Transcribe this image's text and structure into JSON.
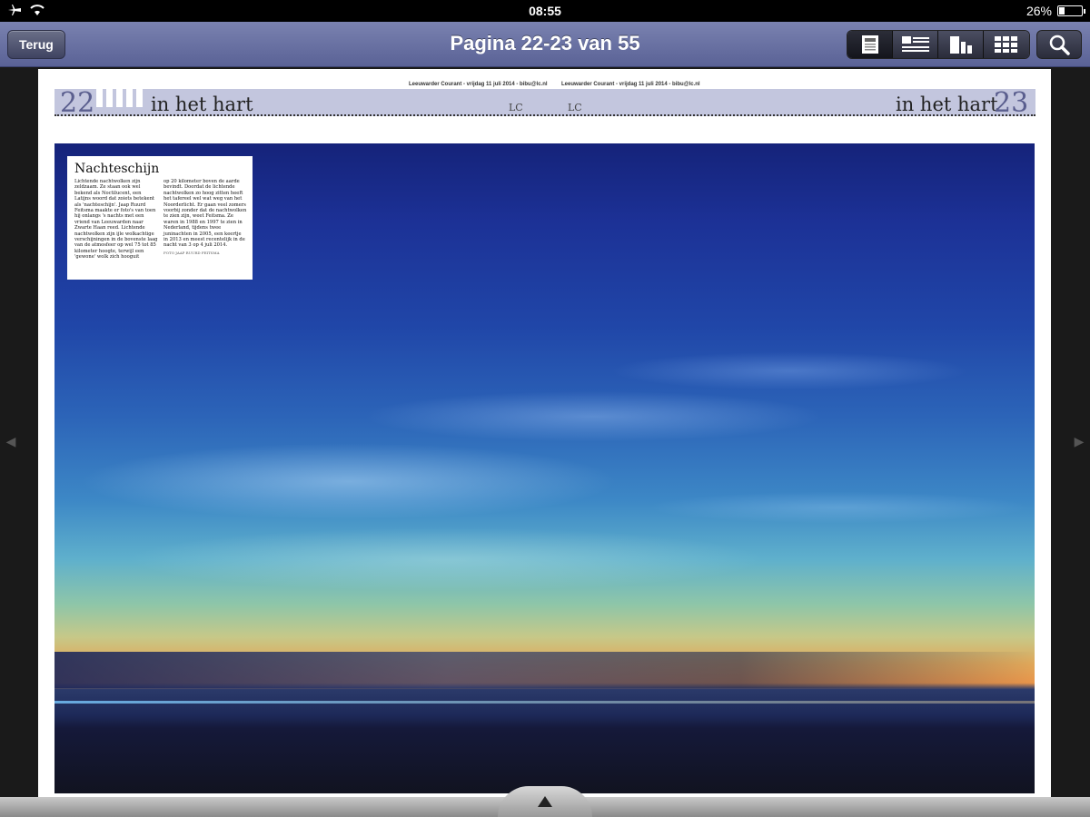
{
  "status_bar": {
    "time": "08:55",
    "battery_text": "26%",
    "battery_level": 0.26
  },
  "navbar": {
    "back_label": "Terug",
    "title": "Pagina 22-23 van 55",
    "view_icons": [
      "single-page-icon",
      "article-list-icon",
      "bar-pages-icon",
      "grid-icon"
    ],
    "search_icon": "magnifier-icon"
  },
  "page": {
    "dateline_left": "Leeuwarder Courant - vrijdag 11 juli 2014 - bibu@lc.nl",
    "dateline_right": "Leeuwarder Courant - vrijdag 11 juli 2014 - bibu@lc.nl",
    "left_page_number": "22",
    "right_page_number": "23",
    "left_section": "in het hart",
    "right_section": "in het hart",
    "left_logo": "LC",
    "right_logo": "LC",
    "band_color": "#c3c6de",
    "page_number_color": "#5a5e8e"
  },
  "caption": {
    "title": "Nachteschijn",
    "col1": "Lichtende nachtwolken zijn zeldzaam. Ze staan ook wel bekend als Noctilucent, een Latijns woord dat zoiets betekent als 'nachteschijn'. Jaap Ruurd Feitsma maakte er foto's van toen hij onlangs 's nachts met een vriend van Leeuwarden naar Zwarte Haan reed. Lichtende nachtwolken zijn ijle wolkachtige verschijningen in de bovenste laag van de atmosfeer op wel 75 tot 85 kilometer hoogte, terwijl een 'gewone' wolk zich hooguit",
    "col2": "op 20 kilometer boven de aarde bevindt. Doordat de lichtende nachtwolken zo hoog zitten heeft het tafereel wel wat weg van het Noorderlicht. Er gaan veel zomers voorbij zonder dat de nachtwolken te zien zijn, weet Feitsma. Ze waren in 1988 en 1997 te zien in Nederland, tijdens twee juninachten in 2005, een keertje in 2013 en meest recentelijk in de nacht van 3 op 4 juli 2014.",
    "credit": "FOTO JAAP RUURD FEITSMA"
  }
}
